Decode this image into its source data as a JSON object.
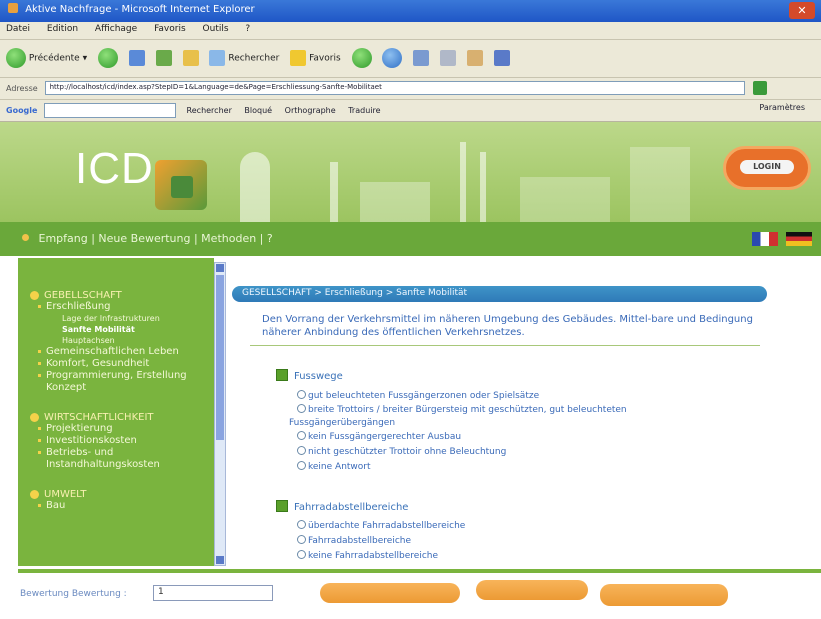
{
  "browser": {
    "title": "Aktive Nachfrage - Microsoft Internet Explorer",
    "menu": [
      "Datei",
      "Edition",
      "Affichage",
      "Favoris",
      "Outils",
      "?"
    ],
    "toolbar": {
      "back": "Précédente",
      "search": "Rechercher",
      "favorites": "Favoris"
    },
    "address_label": "Adresse",
    "url": "http://localhost/icd/index.asp?StepID=1&Language=de&Page=Erschliessung-Sanfte-Mobilitaet",
    "google_label": "Google",
    "google_items": [
      "Rechercher",
      "Bloqué",
      "Orthographe",
      "Traduire",
      "Paramètres"
    ]
  },
  "header": {
    "logo_text": "ICD",
    "login_label": "LOGIN"
  },
  "nav": {
    "items": "Empfang | Neue Bewertung | Methoden | ?"
  },
  "sidebar": {
    "sections": [
      {
        "title": "GEBELLSCHAFT",
        "items": [
          {
            "label": "Erschließung",
            "subs": [
              {
                "label": "Lage der Infrastrukturen",
                "active": false
              },
              {
                "label": "Sanfte Mobilität",
                "active": true
              },
              {
                "label": "Hauptachsen",
                "active": false
              }
            ]
          },
          {
            "label": "Gemeinschaftlichen Leben",
            "subs": []
          },
          {
            "label": "Komfort, Gesundheit",
            "subs": []
          },
          {
            "label": "Programmierung, Erstellung Konzept",
            "subs": []
          }
        ]
      },
      {
        "title": "WIRTSCHAFTLICHKEIT",
        "items": [
          {
            "label": "Projektierung",
            "subs": []
          },
          {
            "label": "Investitionskosten",
            "subs": []
          },
          {
            "label": "Betriebs- und Instandhaltungskosten",
            "subs": []
          }
        ]
      },
      {
        "title": "UMWELT",
        "items": [
          {
            "label": "Bau",
            "subs": []
          }
        ]
      }
    ]
  },
  "main": {
    "breadcrumb": "GESELLSCHAFT > Erschließung > Sanfte Mobilität",
    "intro": "Den Vorrang der Verkehrsmittel im näheren Umgebung des Gebäudes. Mittel-bare und Bedingung näherer Anbindung des öffentlichen Verkehrsnetzes.",
    "groups": [
      {
        "title": "Fusswege",
        "options": [
          "gut beleuchteten Fussgängerzonen oder Spielsätze",
          "breite Trottoirs / breiter Bürgersteig mit geschützten, gut beleuchteten",
          "Fussgängerübergängen",
          "kein Fussgängergerechter Ausbau",
          "nicht geschützter Trottoir ohne Beleuchtung",
          "keine Antwort"
        ]
      },
      {
        "title": "Fahrradabstellbereiche",
        "options": [
          "überdachte Fahrradabstellbereiche",
          "Fahrradabstellbereiche",
          "keine Fahrradabstellbereiche"
        ]
      }
    ]
  },
  "footer": {
    "count_label": "Bewertung Bewertung :",
    "count_value": "1"
  }
}
